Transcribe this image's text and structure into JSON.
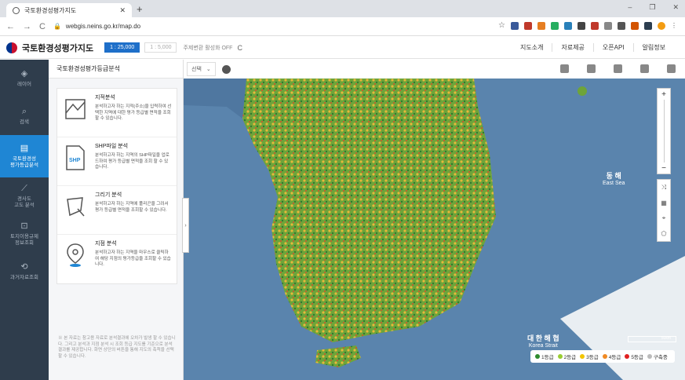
{
  "browser": {
    "tab_title": "국토환경성평가지도",
    "url": "webgis.neins.go.kr/map.do"
  },
  "header": {
    "title": "국토환경성평가지도",
    "scale_active": "1 : 25,000",
    "scale_inactive": "1 : 5,000",
    "coord_toggle": "주제변환 활성화 OFF",
    "nav": [
      "지도소개",
      "자료제공",
      "오픈API",
      "알림정보"
    ]
  },
  "rail": {
    "items": [
      {
        "label": "레이어",
        "icon": "layers-icon",
        "active": false
      },
      {
        "label": "검색",
        "icon": "search-icon",
        "active": false
      },
      {
        "label": "국토환경성\n평가등급분석",
        "icon": "analysis-icon",
        "active": true
      },
      {
        "label": "경사도\n고도 분석",
        "icon": "slope-icon",
        "active": false
      },
      {
        "label": "토지이용규제\n정보조회",
        "icon": "land-icon",
        "active": false
      },
      {
        "label": "과거자료조회",
        "icon": "history-icon",
        "active": false
      }
    ]
  },
  "panel": {
    "title": "국토환경성평가등급분석",
    "cards": [
      {
        "title": "지적분석",
        "desc": "분석하고자 하는 지적(주소)을 입력하여 선택한 지역에 대한 평가 등급별 면적을 조회할 수 있습니다.",
        "icon": "cadastral-icon"
      },
      {
        "title": "SHP파일 분석",
        "desc": "분석하고자 하는 지역의 SHP파일을 업로드하여 평가 등급별 면적을 조회 할 수 있습니다.",
        "icon": "shp-file-icon"
      },
      {
        "title": "그리기 분석",
        "desc": "분석하고자 하는 지역에 폴리곤을 그려서 평가 등급별 면적을 조회할 수 있습니다.",
        "icon": "draw-polygon-icon"
      },
      {
        "title": "지점 분석",
        "desc": "분석하고자 하는 지역을 마우스로 클릭하여 해당 지점의 평가등급을 조회할 수 있습니다.",
        "icon": "point-icon"
      }
    ],
    "footer": "※ 본 자료는 참고용 자료로 분석결과에 오차가 발생 할 수 있습니다. 그리고 분석과 지점 분석 시 조회 등급 지도를 기준으로 분석 결과를 제공합니다. 화면 상단의 버튼을 통해 지도의 축척을 선택할 수 있습니다."
  },
  "map": {
    "select_placeholder": "선택",
    "sea_labels": [
      {
        "ko": "동 해",
        "en": "East Sea"
      },
      {
        "ko": "대 한 해 협",
        "en": "Korea Strait"
      }
    ],
    "scale_text": "50km",
    "legend": [
      {
        "label": "1등급",
        "color": "#2e8b2e"
      },
      {
        "label": "2등급",
        "color": "#9acd32"
      },
      {
        "label": "3등급",
        "color": "#f2c500"
      },
      {
        "label": "4등급",
        "color": "#f08a24"
      },
      {
        "label": "5등급",
        "color": "#e02020"
      },
      {
        "label": "구축중",
        "color": "#bbbbbb"
      }
    ]
  }
}
